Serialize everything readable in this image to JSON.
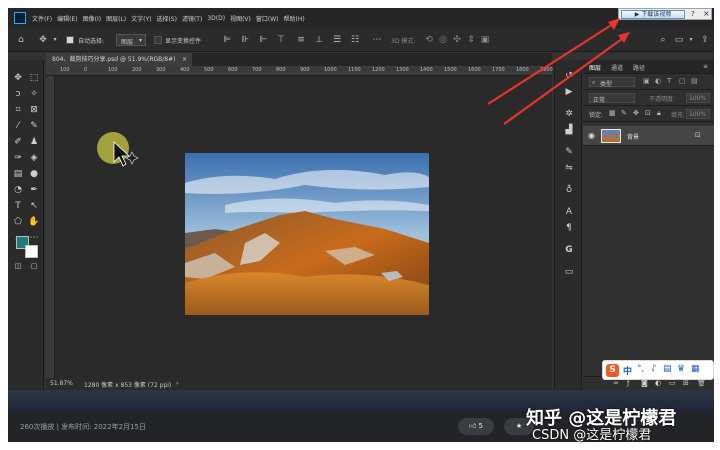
{
  "menubar": {
    "items": [
      "文件(F)",
      "编辑(E)",
      "图像(I)",
      "图层(L)",
      "文字(Y)",
      "选择(S)",
      "滤镜(T)",
      "3D(D)",
      "视图(V)",
      "窗口(W)",
      "帮助(H)"
    ]
  },
  "options_bar": {
    "auto_select_label": "自动选择:",
    "layer_select_value": "图层",
    "show_transform_label": "显示变换控件",
    "mode_label": "3D 模式:"
  },
  "download_bar": {
    "button_label": "▶ 下载该视频",
    "help": "?",
    "close": "×"
  },
  "document": {
    "tab_title": "804、裁剪技巧分享.psd @ 51.9%(RGB/8#)",
    "tab_close": "×",
    "zoom": "51.87%",
    "size_info": "1280 像素 x 853 像素 (72 ppi)"
  },
  "ruler": {
    "ticks": [
      "100",
      "0",
      "100",
      "200",
      "300",
      "400",
      "500",
      "600",
      "700",
      "800",
      "900",
      "1000",
      "1100",
      "1200",
      "1300",
      "1400",
      "1500",
      "1600",
      "1700",
      "1800",
      "1900"
    ]
  },
  "layers_panel": {
    "tabs": [
      "图层",
      "通道",
      "路径"
    ],
    "search_placeholder": "类型",
    "blend_mode": "正常",
    "opacity_label": "不透明度:",
    "opacity_value": "100%",
    "lock_label": "锁定:",
    "fill_label": "填充:",
    "fill_value": "100%",
    "layer_name": "背景"
  },
  "ime": {
    "logo": "S",
    "lang": "中"
  },
  "video_info": {
    "meta": "260次播放 | 发布时间: 2022年2月15日",
    "like_count": "5",
    "watermark_primary": "知乎 @这是柠檬君",
    "watermark_secondary": "CSDN @这是柠檬君"
  },
  "colors": {
    "ps_bg": "#323232",
    "foreground": "#1f7a78",
    "background": "#ffffff",
    "annotation_arrow": "#e8342a"
  }
}
